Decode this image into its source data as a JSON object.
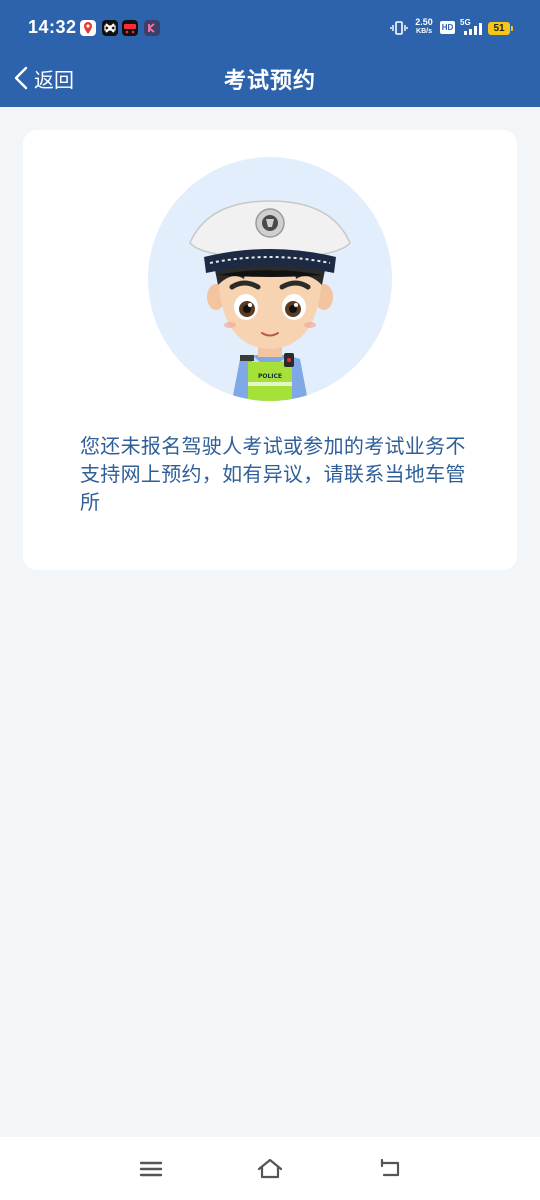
{
  "status_bar": {
    "time": "14:32",
    "net_speed_value": "2.50",
    "net_speed_unit": "KB/s",
    "hd_label": "HD",
    "network_type": "5G",
    "battery_level": "51",
    "app_icons": [
      "map-pin-icon",
      "capcut-icon",
      "tmall-icon",
      "k-app-icon"
    ]
  },
  "header": {
    "back_label": "返回",
    "title": "考试预约"
  },
  "card": {
    "message": "您还未报名驾驶人考试或参加的考试业务不支持网上预约，如有异议，请联系当地车管所",
    "badge_text": "POLICE"
  },
  "colors": {
    "header_bg": "#2d63ad",
    "page_bg": "#f3f6f9",
    "message_text": "#2e5f98",
    "avatar_bg": "#e3eefc",
    "battery": "#f5c518"
  },
  "bottom_nav": {
    "icons": [
      "menu-icon",
      "home-icon",
      "back-icon"
    ]
  }
}
